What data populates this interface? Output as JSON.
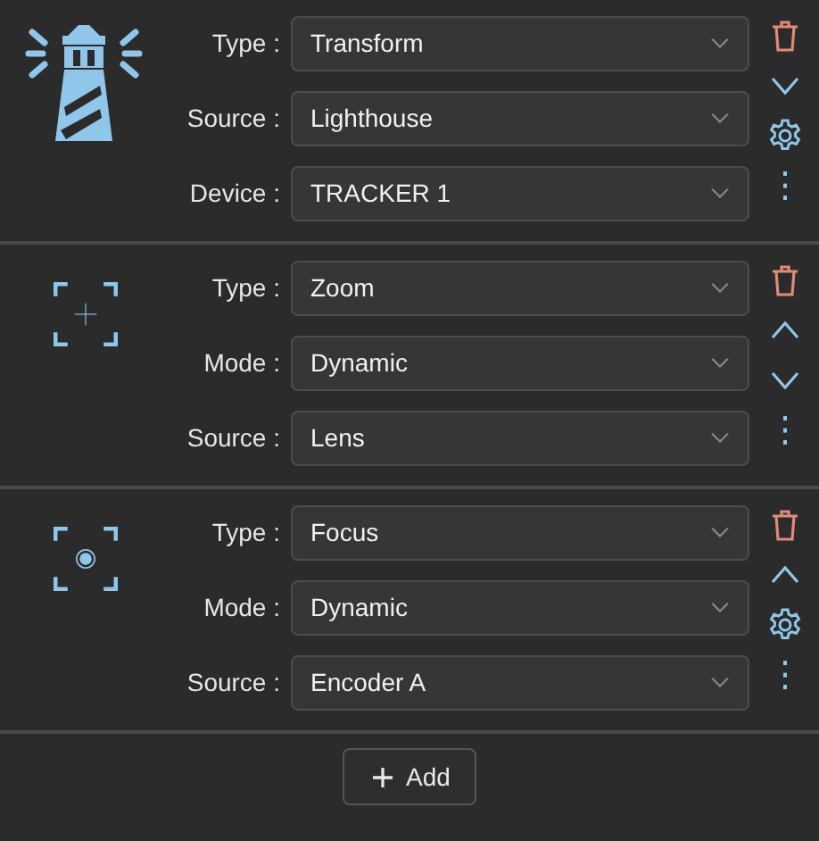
{
  "sections": [
    {
      "kind": "lighthouse",
      "fields": [
        {
          "label": "Type :",
          "value": "Transform"
        },
        {
          "label": "Source :",
          "value": "Lighthouse"
        },
        {
          "label": "Device :",
          "value": "TRACKER 1"
        }
      ],
      "actions": [
        {
          "kind": "delete"
        },
        {
          "kind": "down"
        },
        {
          "kind": "settings"
        },
        {
          "kind": "more"
        }
      ]
    },
    {
      "kind": "zoom",
      "fields": [
        {
          "label": "Type :",
          "value": "Zoom"
        },
        {
          "label": "Mode :",
          "value": "Dynamic"
        },
        {
          "label": "Source :",
          "value": "Lens"
        }
      ],
      "actions": [
        {
          "kind": "delete"
        },
        {
          "kind": "up"
        },
        {
          "kind": "down"
        },
        {
          "kind": "more"
        }
      ]
    },
    {
      "kind": "focus",
      "fields": [
        {
          "label": "Type :",
          "value": "Focus"
        },
        {
          "label": "Mode :",
          "value": "Dynamic"
        },
        {
          "label": "Source :",
          "value": "Encoder A"
        }
      ],
      "actions": [
        {
          "kind": "delete"
        },
        {
          "kind": "up"
        },
        {
          "kind": "settings"
        },
        {
          "kind": "more"
        }
      ]
    }
  ],
  "add_button": {
    "label": "Add"
  }
}
